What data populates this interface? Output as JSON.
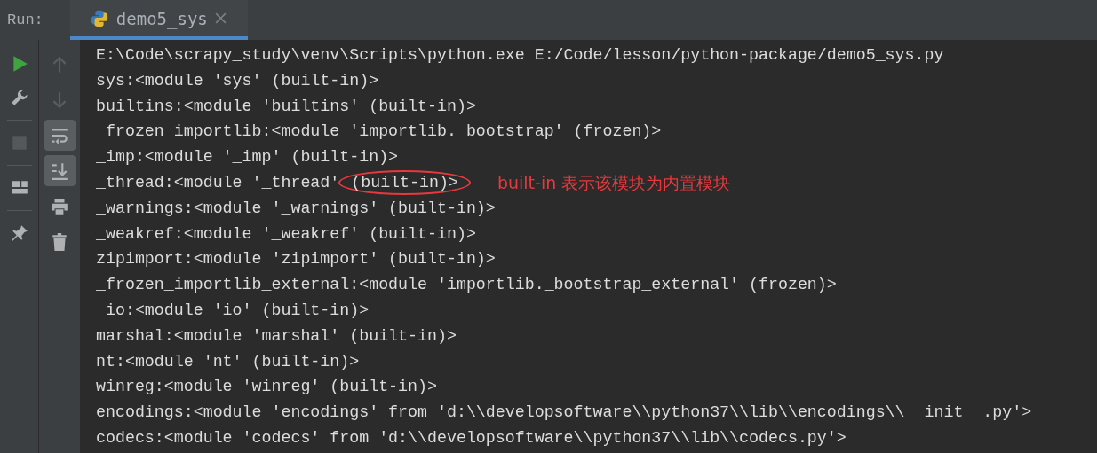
{
  "run_bar": {
    "label": "Run:",
    "tabs": [
      {
        "label": "demo5_sys",
        "selected": true
      }
    ]
  },
  "toolbar": [
    {
      "kind": "run"
    },
    {
      "kind": "wrench"
    },
    {
      "kind": "stop"
    },
    {
      "kind": "layout"
    },
    {
      "kind": "pin"
    }
  ],
  "console_toolbar": [
    {
      "kind": "up",
      "on": false
    },
    {
      "kind": "down",
      "on": false
    },
    {
      "kind": "wrap",
      "on": true
    },
    {
      "kind": "scroll-end",
      "on": true
    },
    {
      "kind": "print",
      "on": false
    },
    {
      "kind": "trash",
      "on": false
    }
  ],
  "console": {
    "lines": [
      {
        "text": "E:\\Code\\scrapy_study\\venv\\Scripts\\python.exe E:/Code/lesson/python-package/demo5_sys.py"
      },
      {
        "text": "sys:<module 'sys' (built-in)>"
      },
      {
        "text": "builtins:<module 'builtins' (built-in)>"
      },
      {
        "text": "_frozen_importlib:<module 'importlib._bootstrap' (frozen)>"
      },
      {
        "text": "_imp:<module '_imp' (built-in)>"
      },
      {
        "text": "_thread:<module '_thread' ",
        "circled": "(built-in)>",
        "note": "built-in 表示该模块为内置模块"
      },
      {
        "text": "_warnings:<module '_warnings' (built-in)>"
      },
      {
        "text": "_weakref:<module '_weakref' (built-in)>"
      },
      {
        "text": "zipimport:<module 'zipimport' (built-in)>"
      },
      {
        "text": "_frozen_importlib_external:<module 'importlib._bootstrap_external' (frozen)>"
      },
      {
        "text": "_io:<module 'io' (built-in)>"
      },
      {
        "text": "marshal:<module 'marshal' (built-in)>"
      },
      {
        "text": "nt:<module 'nt' (built-in)>"
      },
      {
        "text": "winreg:<module 'winreg' (built-in)>"
      },
      {
        "text": "encodings:<module 'encodings' from 'd:\\\\developsoftware\\\\python37\\\\lib\\\\encodings\\\\__init__.py'>"
      },
      {
        "text": "codecs:<module 'codecs' from 'd:\\\\developsoftware\\\\python37\\\\lib\\\\codecs.py'>"
      }
    ]
  }
}
